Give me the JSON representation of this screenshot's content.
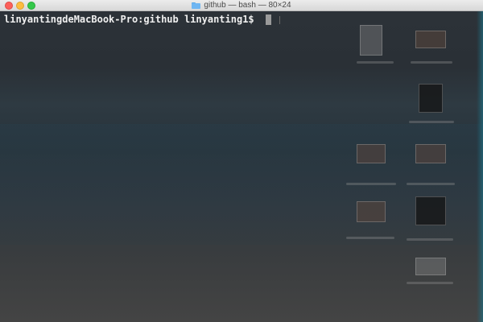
{
  "window": {
    "title": "github — bash — 80×24"
  },
  "terminal": {
    "prompt": "linyantingdeMacBook-Pro:github linyanting1$ "
  },
  "desktop_icons": [
    "document",
    "image",
    "document",
    "image",
    "document",
    "image",
    "document",
    "image"
  ]
}
